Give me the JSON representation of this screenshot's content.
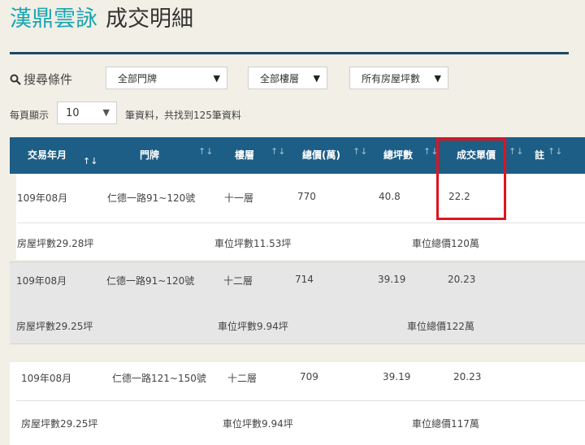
{
  "header": {
    "brand": "漢鼎雲詠",
    "subtitle": "成交明細"
  },
  "filters": {
    "search_label": "搜尋條件",
    "door": "全部門牌",
    "floor": "全部樓層",
    "area": "所有房屋坪數"
  },
  "paging": {
    "label": "每頁顯示",
    "value": "10",
    "result": "筆資料，共找到125筆資料"
  },
  "table": {
    "headers": {
      "date": "交易年月",
      "door": "門牌",
      "floor": "樓層",
      "total": "總價(萬)",
      "area": "總坪數",
      "unit": "成交單價",
      "note": "註"
    },
    "rows": [
      {
        "date": "109年08月",
        "door": "仁德一路91~120號",
        "floor": "十一層",
        "total": "770",
        "area": "40.8",
        "unit": "22.2",
        "house_area": "房屋坪數29.28坪",
        "parking_area": "車位坪數11.53坪",
        "parking_price": "車位總價120萬"
      },
      {
        "date": "109年08月",
        "door": "仁德一路91~120號",
        "floor": "十二層",
        "total": "714",
        "area": "39.19",
        "unit": "20.23",
        "house_area": "房屋坪數29.25坪",
        "parking_area": "車位坪數9.94坪",
        "parking_price": "車位總價122萬"
      },
      {
        "date": "109年08月",
        "door": "仁德一路121~150號",
        "floor": "十二層",
        "total": "709",
        "area": "39.19",
        "unit": "20.23",
        "house_area": "房屋坪數29.25坪",
        "parking_area": "車位坪數9.94坪",
        "parking_price": "車位總價117萬"
      }
    ]
  },
  "colors": {
    "accent": "#1aa6b0",
    "header_bg": "#1d5e86",
    "highlight": "#e0141e"
  }
}
